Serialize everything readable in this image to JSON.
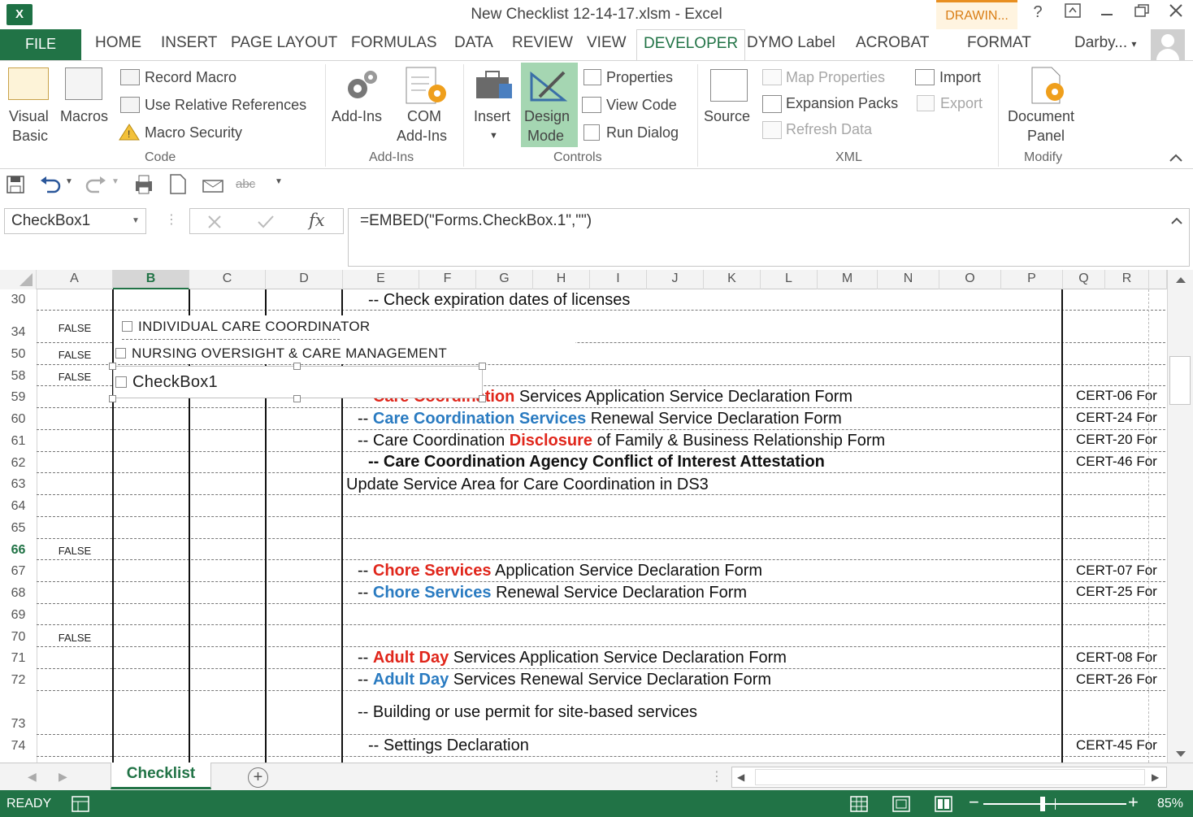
{
  "window": {
    "title": "New Checklist 12-14-17.xlsm - Excel",
    "contextual_tab": "DRAWIN...",
    "help": "?",
    "app_icon": "excel-icon"
  },
  "tabs": {
    "file": "FILE",
    "home": "HOME",
    "insert": "INSERT",
    "page_layout": "PAGE LAYOUT",
    "formulas": "FORMULAS",
    "data": "DATA",
    "review": "REVIEW",
    "view": "VIEW",
    "developer": "DEVELOPER",
    "dymo": "DYMO Label",
    "acrobat": "ACROBAT",
    "format": "FORMAT",
    "user": "Darby..."
  },
  "ribbon": {
    "code": {
      "visual_basic_1": "Visual",
      "visual_basic_2": "Basic",
      "macros": "Macros",
      "record_macro": "Record Macro",
      "relative_refs": "Use Relative References",
      "macro_security": "Macro Security",
      "group": "Code"
    },
    "addins": {
      "addins": "Add-Ins",
      "com_1": "COM",
      "com_2": "Add-Ins",
      "group": "Add-Ins"
    },
    "controls": {
      "insert": "Insert",
      "design_1": "Design",
      "design_2": "Mode",
      "properties": "Properties",
      "view_code": "View Code",
      "run_dialog": "Run Dialog",
      "group": "Controls"
    },
    "xml": {
      "source": "Source",
      "map_properties": "Map Properties",
      "expansion_packs": "Expansion Packs",
      "refresh_data": "Refresh Data",
      "import": "Import",
      "export": "Export",
      "group": "XML"
    },
    "modify": {
      "doc_1": "Document",
      "doc_2": "Panel",
      "group": "Modify"
    }
  },
  "formula_bar": {
    "name_box": "CheckBox1",
    "fx": "fx",
    "formula": "=EMBED(\"Forms.CheckBox.1\",\"\")"
  },
  "columns": [
    "A",
    "B",
    "C",
    "D",
    "E",
    "F",
    "G",
    "H",
    "I",
    "J",
    "K",
    "L",
    "M",
    "N",
    "O",
    "P",
    "Q",
    "R"
  ],
  "selected_column": "B",
  "rows": {
    "r30": "30",
    "r34": "34",
    "r50": "50",
    "r58": "58",
    "r59": "59",
    "r60": "60",
    "r61": "61",
    "r62": "62",
    "r63": "63",
    "r64": "64",
    "r65": "65",
    "r66": "66",
    "r67": "67",
    "r68": "68",
    "r69": "69",
    "r70": "70",
    "r71": "71",
    "r72": "72",
    "r73": "73",
    "r74": "74"
  },
  "false_value": "FALSE",
  "checkboxes": {
    "cb1": "INDIVIDUAL CARE COORDINATOR",
    "cb2": "NURSING OVERSIGHT & CARE MANAGEMENT",
    "cb3": "CheckBox1"
  },
  "cells": {
    "r30": "-- Check expiration dates of licenses",
    "r59_red": "Care Coordination",
    "r59_rest": " Services Application Service Declaration Form",
    "r59_q": "CERT-06 For",
    "r60_pre": "-- ",
    "r60_blue": "Care Coordination Services",
    "r60_rest": " Renewal Service Declaration Form",
    "r60_q": "CERT-24 For",
    "r61_pre": "-- Care Coordination ",
    "r61_red": "Disclosure",
    "r61_rest": " of Family & Business Relationship Form",
    "r61_q": "CERT-20 For",
    "r62": "-- Care Coordination Agency Conflict of Interest Attestation",
    "r62_q": "CERT-46 For",
    "r63": "Update Service Area for Care Coordination in DS3",
    "r67_pre": "-- ",
    "r67_red": "Chore Services",
    "r67_rest": " Application Service Declaration Form",
    "r67_q": "CERT-07 For",
    "r68_pre": "-- ",
    "r68_blue": "Chore Services",
    "r68_rest": " Renewal Service Declaration Form",
    "r68_q": "CERT-25 For",
    "r71_pre": "-- ",
    "r71_red": "Adult Day",
    "r71_rest": " Services Application Service Declaration Form",
    "r71_q": "CERT-08 For",
    "r72_pre": "-- ",
    "r72_blue": "Adult Day",
    "r72_rest": " Services Renewal Service Declaration Form",
    "r72_q": "CERT-26 For",
    "r73": "-- Building or use permit for site-based services",
    "r74": "-- Settings Declaration",
    "r74_q": "CERT-45 For"
  },
  "sheet": {
    "tab": "Checklist",
    "add": "+"
  },
  "status": {
    "ready": "READY",
    "zoom": "85%"
  },
  "colors": {
    "excel_green": "#217346",
    "red_text": "#e0261b",
    "blue_text": "#2a7bc1"
  }
}
